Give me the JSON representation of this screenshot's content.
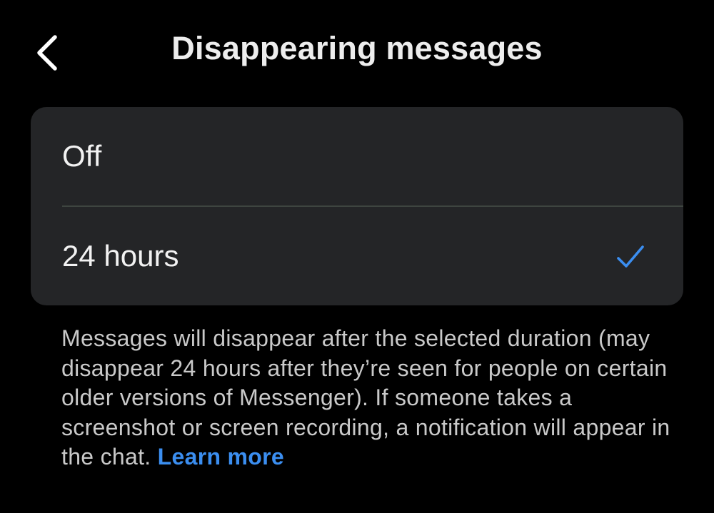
{
  "header": {
    "title": "Disappearing messages",
    "back_icon": "chevron-left-icon"
  },
  "options": [
    {
      "label": "Off",
      "selected": false
    },
    {
      "label": "24 hours",
      "selected": true
    }
  ],
  "selected_check_icon": "checkmark-icon",
  "description": {
    "text": "Messages will disappear after the selected duration (may disappear 24 hours after they’re seen for people on certain older versions of Messenger). If someone takes a screenshot or screen recording, a notification will appear in the chat.",
    "link_label": "Learn more"
  },
  "colors": {
    "background": "#000000",
    "card": "#242527",
    "accent": "#3b8ef0",
    "text_primary": "#f2f2f2",
    "text_secondary": "#c9c9c9"
  }
}
